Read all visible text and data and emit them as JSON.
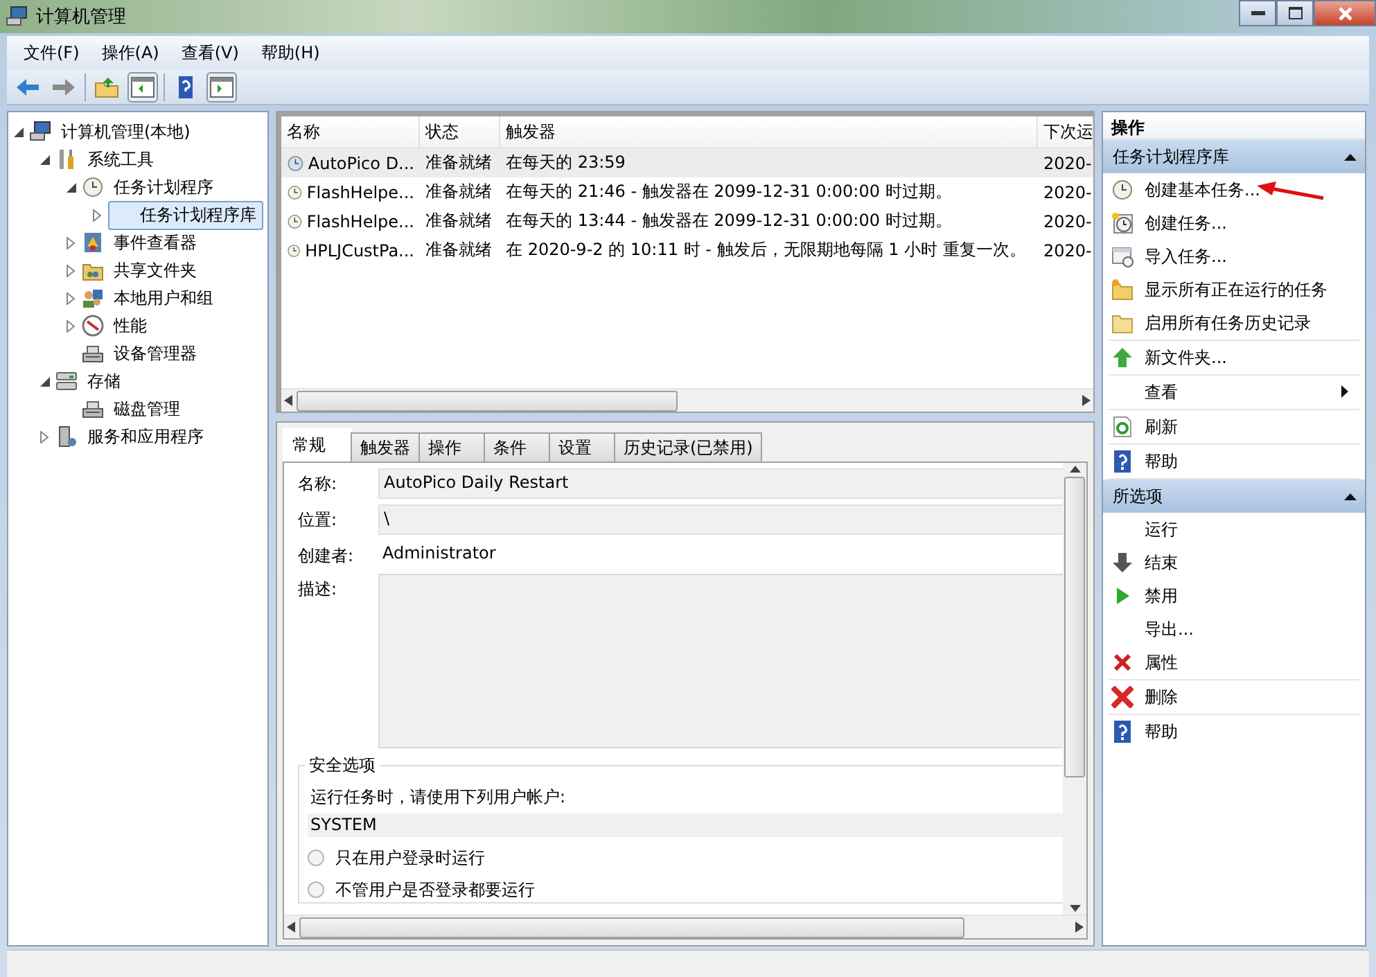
{
  "window": {
    "title": "计算机管理"
  },
  "menu": [
    "文件(F)",
    "操作(A)",
    "查看(V)",
    "帮助(H)"
  ],
  "tree": [
    {
      "label": "计算机管理(本地)",
      "kind": "computer",
      "expanded": true,
      "selected": false,
      "children": [
        {
          "label": "系统工具",
          "kind": "tools",
          "expanded": true,
          "selected": false,
          "children": [
            {
              "label": "任务计划程序",
              "kind": "clock",
              "expanded": true,
              "selected": false,
              "children": [
                {
                  "label": "任务计划程序库",
                  "expanded": false,
                  "selected": true
                }
              ]
            },
            {
              "label": "事件查看器",
              "kind": "log",
              "expanded": false,
              "selected": false
            },
            {
              "label": "共享文件夹",
              "kind": "share",
              "expanded": false,
              "selected": false
            },
            {
              "label": "本地用户和组",
              "kind": "users",
              "expanded": false,
              "selected": false
            },
            {
              "label": "性能",
              "kind": "gauge",
              "expanded": false,
              "selected": false
            },
            {
              "label": "设备管理器",
              "kind": "device",
              "selected": false
            }
          ]
        },
        {
          "label": "存储",
          "kind": "storage",
          "expanded": true,
          "selected": false,
          "children": [
            {
              "label": "磁盘管理",
              "kind": "device",
              "selected": false
            }
          ]
        },
        {
          "label": "服务和应用程序",
          "kind": "server",
          "expanded": false,
          "selected": false
        }
      ]
    }
  ],
  "tasks": {
    "columns": [
      "名称",
      "状态",
      "触发器",
      "下次运"
    ],
    "rows": [
      {
        "selected": true,
        "cells": [
          "AutoPico D...",
          "准备就绪",
          "在每天的 23:59",
          "2020-"
        ]
      },
      {
        "selected": false,
        "cells": [
          "FlashHelpe...",
          "准备就绪",
          "在每天的 21:46 - 触发器在 2099-12-31 0:00:00 时过期。",
          "2020-"
        ]
      },
      {
        "selected": false,
        "cells": [
          "FlashHelpe...",
          "准备就绪",
          "在每天的 13:44 - 触发器在 2099-12-31 0:00:00 时过期。",
          "2020-"
        ]
      },
      {
        "selected": false,
        "cells": [
          "HPLJCustPa...",
          "准备就绪",
          "在 2020-9-2 的 10:11 时 - 触发后，无限期地每隔 1 小时 重复一次。",
          "2020-"
        ]
      }
    ]
  },
  "details": {
    "tabs": [
      {
        "label": "常规",
        "selected": true
      },
      {
        "label": "触发器",
        "selected": false
      },
      {
        "label": "操作",
        "selected": false
      },
      {
        "label": "条件",
        "selected": false
      },
      {
        "label": "设置",
        "selected": false
      },
      {
        "label": "历史记录(已禁用)",
        "selected": false
      }
    ],
    "name_label": "名称:",
    "name_value": "AutoPico Daily Restart",
    "location_label": "位置:",
    "location_value": "\\",
    "author_label": "创建者:",
    "author_value": "Administrator",
    "description_label": "描述:",
    "security": {
      "legend": "安全选项",
      "run_as_label": "运行任务时，请使用下列用户帐户:",
      "account": "SYSTEM",
      "options": [
        {
          "label": "只在用户登录时运行",
          "selected": false
        },
        {
          "label": "不管用户是否登录都要运行",
          "selected": false
        }
      ]
    }
  },
  "actions": {
    "title": "操作",
    "sections": [
      {
        "title": "任务计划程序库",
        "expanded": true,
        "groups": [
          [
            {
              "label": "创建基本任务...",
              "kind": "clock"
            },
            {
              "label": "创建任务...",
              "kind": "newclock"
            },
            {
              "label": "导入任务...",
              "kind": "import"
            },
            {
              "label": "显示所有正在运行的任务",
              "kind": "folderstar"
            },
            {
              "label": "启用所有任务历史记录",
              "kind": "folder"
            }
          ],
          [
            {
              "label": "新文件夹...",
              "kind": "up"
            }
          ],
          [
            {
              "label": "查看",
              "submenu": true
            }
          ],
          [
            {
              "label": "刷新",
              "kind": "refresh"
            }
          ],
          [
            {
              "label": "帮助",
              "kind": "help"
            }
          ]
        ]
      },
      {
        "title": "所选项",
        "expanded": true,
        "groups": [
          [
            {
              "label": "运行"
            },
            {
              "label": "结束",
              "kind": "down"
            },
            {
              "label": "禁用",
              "kind": "play"
            },
            {
              "label": "导出..."
            },
            {
              "label": "属性",
              "kind": "xsmall"
            }
          ],
          [
            {
              "label": "删除",
              "kind": "xbig"
            }
          ],
          [
            {
              "label": "帮助",
              "kind": "help"
            }
          ]
        ]
      }
    ]
  }
}
